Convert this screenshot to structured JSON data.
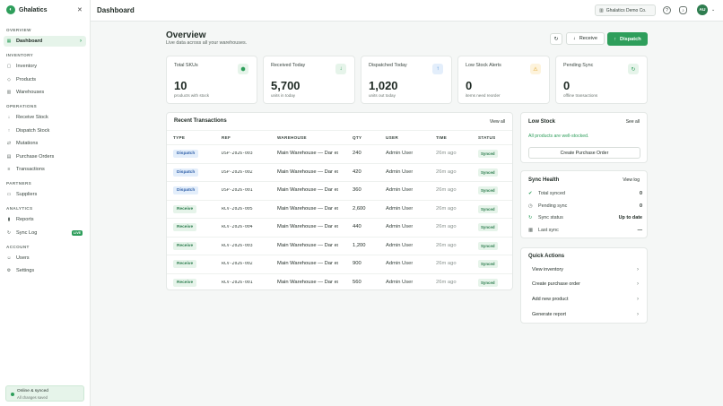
{
  "app": {
    "brand": "Ghalatics"
  },
  "sidebar": {
    "sections": [
      {
        "label": "OVERVIEW"
      },
      {
        "label": "INVENTORY"
      },
      {
        "label": "OPERATIONS"
      },
      {
        "label": "PARTNERS"
      },
      {
        "label": "ANALYTICS"
      },
      {
        "label": "ACCOUNT"
      }
    ],
    "items": [
      {
        "label": "Dashboard",
        "icon": "grid-icon"
      },
      {
        "label": "Inventory",
        "icon": "box-icon"
      },
      {
        "label": "Products",
        "icon": "tag-icon"
      },
      {
        "label": "Warehouses",
        "icon": "building-icon"
      },
      {
        "label": "Receive Stock",
        "icon": "download-icon"
      },
      {
        "label": "Dispatch Stock",
        "icon": "upload-icon"
      },
      {
        "label": "Mutations",
        "icon": "swap-icon"
      },
      {
        "label": "Purchase Orders",
        "icon": "cart-icon"
      },
      {
        "label": "Transactions",
        "icon": "list-icon"
      },
      {
        "label": "Suppliers",
        "icon": "truck-icon"
      },
      {
        "label": "Reports",
        "icon": "chart-icon"
      },
      {
        "label": "Sync Log",
        "icon": "sync-icon",
        "badge": "LIVE"
      },
      {
        "label": "Users",
        "icon": "users-icon"
      },
      {
        "label": "Settings",
        "icon": "gear-icon"
      }
    ],
    "status": {
      "title": "Online & synced",
      "subtitle": "All changes saved"
    }
  },
  "header": {
    "title": "Dashboard",
    "org": "Ghalatics Demo Co.",
    "avatar": "AU"
  },
  "overview": {
    "title": "Overview",
    "subtitle": "Live data across all your warehouses.",
    "receive_label": "Receive",
    "dispatch_label": "Dispatch"
  },
  "kpis": [
    {
      "label": "Total SKUs",
      "value": "10",
      "sub": "products with stock",
      "icon": "cube-icon",
      "color": "#2e9e5b",
      "bg": "#e6f4ea"
    },
    {
      "label": "Received Today",
      "value": "5,700",
      "sub": "units in today",
      "icon": "arrow-down-icon",
      "color": "#2e9e5b",
      "bg": "#e6f4ea"
    },
    {
      "label": "Dispatched Today",
      "value": "1,020",
      "sub": "units out today",
      "icon": "arrow-up-icon",
      "color": "#2f7fd1",
      "bg": "#e3eefb"
    },
    {
      "label": "Low Stock Alerts",
      "value": "0",
      "sub": "items need reorder",
      "icon": "warning-icon",
      "color": "#e0a020",
      "bg": "#fdf3dc"
    },
    {
      "label": "Pending Sync",
      "value": "0",
      "sub": "offline transactions",
      "icon": "sync-icon",
      "color": "#2e9e5b",
      "bg": "#e6f4ea"
    }
  ],
  "transactions": {
    "title": "Recent Transactions",
    "link": "View all",
    "columns": {
      "type": "TYPE",
      "ref": "REF",
      "warehouse": "WAREHOUSE",
      "qty": "QTY",
      "user": "USER",
      "time": "TIME",
      "status": "STATUS"
    },
    "rows": [
      {
        "type": "Dispatch",
        "ref": "DSP-2026-003",
        "warehouse": "Main Warehouse — Dar es Salaam",
        "qty": "240",
        "user": "Admin User",
        "time": "26m ago",
        "status": "Synced"
      },
      {
        "type": "Dispatch",
        "ref": "DSP-2026-002",
        "warehouse": "Main Warehouse — Dar es Salaam",
        "qty": "420",
        "user": "Admin User",
        "time": "26m ago",
        "status": "Synced"
      },
      {
        "type": "Dispatch",
        "ref": "DSP-2026-001",
        "warehouse": "Main Warehouse — Dar es Salaam",
        "qty": "360",
        "user": "Admin User",
        "time": "26m ago",
        "status": "Synced"
      },
      {
        "type": "Receive",
        "ref": "RCV-2026-005",
        "warehouse": "Main Warehouse — Dar es Salaam",
        "qty": "2,600",
        "user": "Admin User",
        "time": "26m ago",
        "status": "Synced"
      },
      {
        "type": "Receive",
        "ref": "RCV-2026-004",
        "warehouse": "Main Warehouse — Dar es Salaam",
        "qty": "440",
        "user": "Admin User",
        "time": "26m ago",
        "status": "Synced"
      },
      {
        "type": "Receive",
        "ref": "RCV-2026-003",
        "warehouse": "Main Warehouse — Dar es Salaam",
        "qty": "1,200",
        "user": "Admin User",
        "time": "26m ago",
        "status": "Synced"
      },
      {
        "type": "Receive",
        "ref": "RCV-2026-002",
        "warehouse": "Main Warehouse — Dar es Salaam",
        "qty": "900",
        "user": "Admin User",
        "time": "26m ago",
        "status": "Synced"
      },
      {
        "type": "Receive",
        "ref": "RCV-2026-001",
        "warehouse": "Main Warehouse — Dar es Salaam",
        "qty": "560",
        "user": "Admin User",
        "time": "26m ago",
        "status": "Synced"
      }
    ]
  },
  "low_stock": {
    "title": "Low Stock",
    "link": "See all",
    "message": "All products are well-stocked.",
    "button": "Create Purchase Order"
  },
  "sync_health": {
    "title": "Sync Health",
    "link": "View log",
    "rows": [
      {
        "label": "Total synced",
        "value": "0",
        "icon": "check-circle-icon"
      },
      {
        "label": "Pending sync",
        "value": "0",
        "icon": "clock-icon"
      },
      {
        "label": "Sync status",
        "value": "Up to date",
        "icon": "sync-icon"
      },
      {
        "label": "Last sync",
        "value": "—",
        "icon": "calendar-icon"
      }
    ]
  },
  "quick_actions": {
    "title": "Quick Actions",
    "items": [
      {
        "label": "View inventory"
      },
      {
        "label": "Create purchase order"
      },
      {
        "label": "Add new product"
      },
      {
        "label": "Generate report"
      }
    ]
  }
}
